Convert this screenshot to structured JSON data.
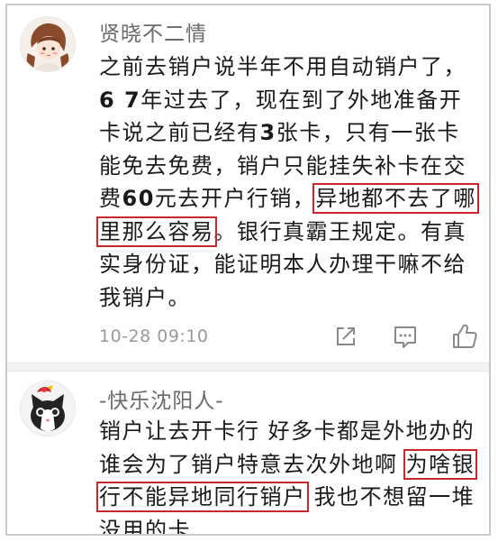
{
  "comments": [
    {
      "username": "贤晓不二情",
      "avatar_icon": "girl-avatar-icon",
      "lines": [
        {
          "parts": [
            {
              "text": "之前去销户说半年不用自动销户了，"
            }
          ]
        },
        {
          "parts": [
            {
              "text": "6 7",
              "bold": true
            },
            {
              "text": "年过去了，现在到了外地准备开"
            }
          ]
        },
        {
          "parts": [
            {
              "text": "卡说之前已经有"
            },
            {
              "text": "3",
              "bold": true
            },
            {
              "text": "张卡，只有一张卡"
            }
          ]
        },
        {
          "parts": [
            {
              "text": "能免去免费，销户只能挂失补卡在交"
            }
          ]
        },
        {
          "parts": [
            {
              "text": "费"
            },
            {
              "text": "60",
              "bold": true
            },
            {
              "text": "元去开户行销，"
            },
            {
              "text": "异地都不去了哪",
              "highlight": true
            }
          ]
        },
        {
          "parts": [
            {
              "text": "里那么容易",
              "highlight": true
            },
            {
              "text": "。银行真霸王规定。有真"
            }
          ]
        },
        {
          "parts": [
            {
              "text": "实身份证，能证明本人办理干嘛不给"
            }
          ]
        },
        {
          "parts": [
            {
              "text": "我销户。"
            }
          ]
        }
      ],
      "timestamp": "10-28 09:10",
      "actions": [
        "share-icon",
        "reply-icon",
        "like-icon"
      ]
    },
    {
      "username": "-快乐沈阳人-",
      "avatar_icon": "cat-avatar-icon",
      "lines": [
        {
          "parts": [
            {
              "text": "销户让去开卡行 好多卡都是外地办的"
            }
          ]
        },
        {
          "parts": [
            {
              "text": "谁会为了销户特意去次外地啊 "
            },
            {
              "text": "为啥银",
              "highlight": true
            }
          ]
        },
        {
          "parts": [
            {
              "text": "行不能异地同行销户",
              "highlight": true
            },
            {
              "text": " 我也不想留一堆"
            }
          ]
        },
        {
          "parts": [
            {
              "text": "没用的卡"
            }
          ]
        }
      ]
    }
  ],
  "colors": {
    "highlight_border": "#c8282d",
    "username": "#6a6a6a",
    "timestamp": "#9a9a9a",
    "icon_stroke": "#8a8a8a"
  }
}
